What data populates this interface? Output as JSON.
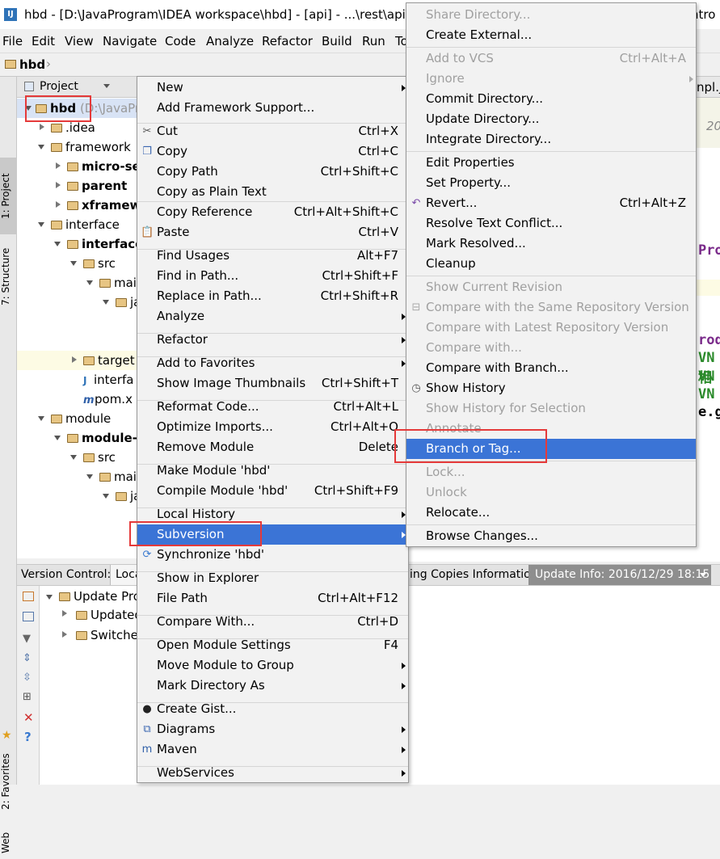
{
  "window": {
    "title": "hbd - [D:\\JavaProgram\\IDEA workspace\\hbd] - [api] - ...\\rest\\api\\s",
    "title_right": "ntro"
  },
  "menubar": [
    "File",
    "Edit",
    "View",
    "Navigate",
    "Code",
    "Analyze",
    "Refactor",
    "Build",
    "Run",
    "To"
  ],
  "navbar": {
    "crumb": "hbd"
  },
  "left_tools": {
    "project": "1: Project",
    "structure": "7: Structure",
    "favorites": "2: Favorites",
    "web": "Web"
  },
  "project_panel": {
    "header": "Project"
  },
  "tree": [
    {
      "label": "hbd",
      "suffix": "(D:\\JavaPr",
      "bold": true
    },
    {
      "label": ".idea"
    },
    {
      "label": "framework"
    },
    {
      "label": "micro-se",
      "bold": true
    },
    {
      "label": "parent",
      "bold": true
    },
    {
      "label": "xframew",
      "bold": true
    },
    {
      "label": "interface"
    },
    {
      "label": "interface",
      "bold": true
    },
    {
      "label": "src"
    },
    {
      "label": "mai"
    },
    {
      "label": "ja"
    },
    {
      "label": "target"
    },
    {
      "label": "interfa"
    },
    {
      "label": "pom.x"
    },
    {
      "label": "module"
    },
    {
      "label": "module-",
      "bold": true
    },
    {
      "label": "src"
    },
    {
      "label": "mai"
    },
    {
      "label": "ja"
    }
  ],
  "editor": {
    "tab": "npl.ja",
    "year": "20",
    "code": [
      "Pro",
      "rod",
      "VN相",
      "VN",
      "VN",
      "e.g"
    ]
  },
  "bottom_bar": {
    "vc": "Version Control:",
    "local": "Loca",
    "working": "ing Copies Information",
    "update_info": "Update Info: 2016/12/29 18:15"
  },
  "bottom_tree": [
    "Update Pro",
    "Updated",
    "Switche"
  ],
  "context_menu": [
    {
      "label": "New",
      "shortcut": "",
      "sub": true
    },
    {
      "label": "Add Framework Support...",
      "shortcut": ""
    },
    {
      "label": "Cut",
      "shortcut": "Ctrl+X",
      "icon": "cut-icon"
    },
    {
      "label": "Copy",
      "shortcut": "Ctrl+C",
      "icon": "copy-icon"
    },
    {
      "label": "Copy Path",
      "shortcut": "Ctrl+Shift+C"
    },
    {
      "label": "Copy as Plain Text",
      "shortcut": ""
    },
    {
      "label": "Copy Reference",
      "shortcut": "Ctrl+Alt+Shift+C"
    },
    {
      "label": "Paste",
      "shortcut": "Ctrl+V",
      "icon": "paste-icon"
    },
    {
      "label": "Find Usages",
      "shortcut": "Alt+F7"
    },
    {
      "label": "Find in Path...",
      "shortcut": "Ctrl+Shift+F"
    },
    {
      "label": "Replace in Path...",
      "shortcut": "Ctrl+Shift+R"
    },
    {
      "label": "Analyze",
      "shortcut": "",
      "sub": true
    },
    {
      "label": "Refactor",
      "shortcut": "",
      "sub": true
    },
    {
      "label": "Add to Favorites",
      "shortcut": "",
      "sub": true
    },
    {
      "label": "Show Image Thumbnails",
      "shortcut": "Ctrl+Shift+T"
    },
    {
      "label": "Reformat Code...",
      "shortcut": "Ctrl+Alt+L"
    },
    {
      "label": "Optimize Imports...",
      "shortcut": "Ctrl+Alt+O"
    },
    {
      "label": "Remove Module",
      "shortcut": "Delete"
    },
    {
      "label": "Make Module 'hbd'",
      "shortcut": ""
    },
    {
      "label": "Compile Module 'hbd'",
      "shortcut": "Ctrl+Shift+F9"
    },
    {
      "label": "Local History",
      "shortcut": "",
      "sub": true
    },
    {
      "label": "Subversion",
      "shortcut": "",
      "sub": true,
      "selected": true
    },
    {
      "label": "Synchronize 'hbd'",
      "shortcut": "",
      "icon": "sync-icon"
    },
    {
      "label": "Show in Explorer",
      "shortcut": ""
    },
    {
      "label": "File Path",
      "shortcut": "Ctrl+Alt+F12"
    },
    {
      "label": "Compare With...",
      "shortcut": "Ctrl+D"
    },
    {
      "label": "Open Module Settings",
      "shortcut": "F4"
    },
    {
      "label": "Move Module to Group",
      "shortcut": "",
      "sub": true
    },
    {
      "label": "Mark Directory As",
      "shortcut": "",
      "sub": true
    },
    {
      "label": "Create Gist...",
      "shortcut": "",
      "icon": "github-icon"
    },
    {
      "label": "Diagrams",
      "shortcut": "",
      "sub": true,
      "icon": "diagram-icon"
    },
    {
      "label": "Maven",
      "shortcut": "",
      "sub": true,
      "icon": "maven-icon"
    },
    {
      "label": "WebServices",
      "shortcut": "",
      "sub": true
    }
  ],
  "svn_menu": [
    {
      "label": "Share Directory...",
      "disabled": true
    },
    {
      "label": "Create External..."
    },
    {
      "label": "Add to VCS",
      "shortcut": "Ctrl+Alt+A",
      "disabled": true
    },
    {
      "label": "Ignore",
      "disabled": true,
      "sub": true
    },
    {
      "label": "Commit Directory..."
    },
    {
      "label": "Update Directory..."
    },
    {
      "label": "Integrate Directory..."
    },
    {
      "label": "Edit Properties"
    },
    {
      "label": "Set Property..."
    },
    {
      "label": "Revert...",
      "shortcut": "Ctrl+Alt+Z",
      "icon": "revert-icon"
    },
    {
      "label": "Resolve Text Conflict..."
    },
    {
      "label": "Mark Resolved..."
    },
    {
      "label": "Cleanup"
    },
    {
      "label": "Show Current Revision",
      "disabled": true
    },
    {
      "label": "Compare with the Same Repository Version",
      "disabled": true,
      "icon": "compare-icon"
    },
    {
      "label": "Compare with Latest Repository Version",
      "disabled": true
    },
    {
      "label": "Compare with...",
      "disabled": true
    },
    {
      "label": "Compare with Branch..."
    },
    {
      "label": "Show History",
      "icon": "history-icon"
    },
    {
      "label": "Show History for Selection",
      "disabled": true
    },
    {
      "label": "Annotate",
      "disabled": true
    },
    {
      "label": "Branch or Tag...",
      "selected": true
    },
    {
      "label": "Lock...",
      "disabled": true
    },
    {
      "label": "Unlock",
      "disabled": true
    },
    {
      "label": "Relocate..."
    },
    {
      "label": "Browse Changes..."
    }
  ],
  "colors": {
    "selection": "#3b74d6",
    "highlight_box": "#e53a3a"
  }
}
